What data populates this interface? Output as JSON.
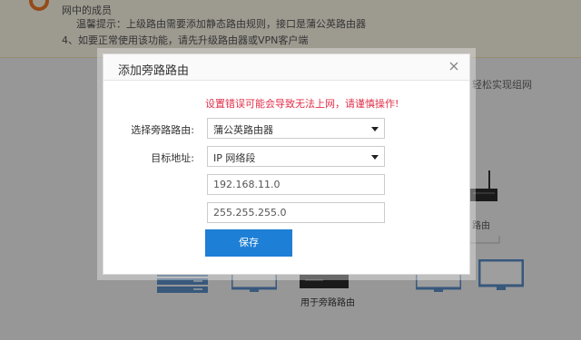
{
  "background": {
    "notice_lines": [
      "网中的成员",
      "温馨提示：上级路由需要添加静态路由规则，接口是蒲公英路由器",
      "4、如要正常使用该功能，请先升级路由器或VPN客户端"
    ],
    "side_text": "轻松实现组网",
    "side_device_label": "路由",
    "bottom_device_label": "用于旁路路由"
  },
  "dialog": {
    "title": "添加旁路路由",
    "warning": "设置错误可能会导致无法上网，请谨慎操作!",
    "router_label": "选择旁路路由:",
    "router_value": "蒲公英路由器",
    "target_label": "目标地址:",
    "target_value": "IP 网络段",
    "ip_value": "192.168.11.0",
    "mask_value": "255.255.255.0",
    "save_label": "保存"
  },
  "colors": {
    "accent": "#1e7fd6",
    "warning": "#e0304a",
    "notice_bg": "#fdf8e8"
  }
}
